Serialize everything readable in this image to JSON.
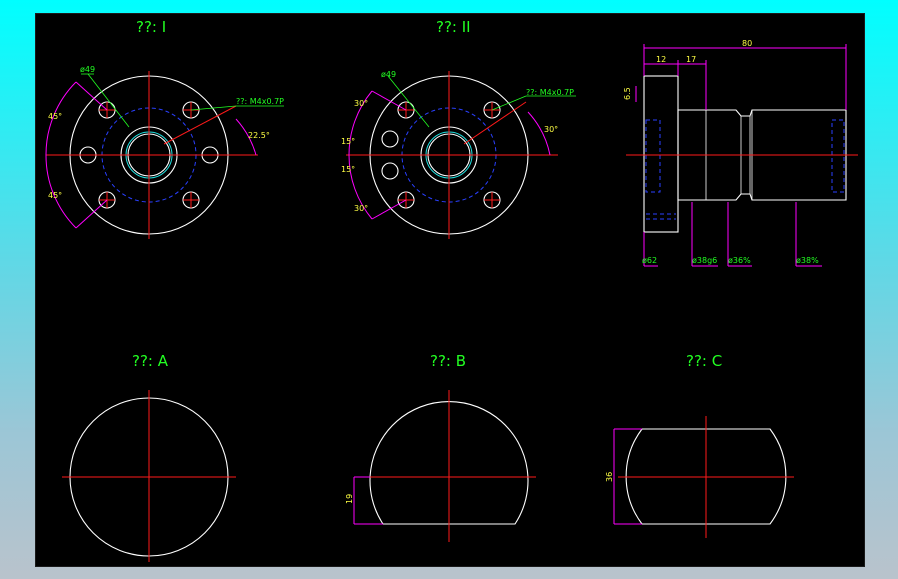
{
  "views": {
    "view_1": {
      "title": "??: I",
      "labels": {
        "pcd": "ø49",
        "tap": "??: M4x0.7P",
        "angle_top": "45°",
        "angle_bot": "45°",
        "angle_r": "22.5°"
      }
    },
    "view_2": {
      "title": "??: II",
      "labels": {
        "pcd": "ø49",
        "tap": "??: M4x0.7P",
        "a1": "30°",
        "a2": "15°",
        "a3": "15°",
        "a4": "30°",
        "a_r": "30°"
      }
    },
    "side": {
      "labels": {
        "total_len": "80",
        "flange_thk": "12",
        "step_len": "17",
        "thk_small": "6.5"
      },
      "diameters": [
        "ø62",
        "ø38g6",
        "ø36%",
        "ø38%"
      ]
    },
    "view_a": {
      "title": "??: A"
    },
    "view_b": {
      "title": "??: B",
      "labels": {
        "flat": "19"
      }
    },
    "view_c": {
      "title": "??: C",
      "labels": {
        "width": "36"
      }
    }
  },
  "colors": {
    "background": "#000000",
    "outline": "#ffffff",
    "centerline": "#ff1a1a",
    "hidden": "#2a40ff",
    "dimension": "#ff00ff",
    "text": "#22ff22"
  }
}
